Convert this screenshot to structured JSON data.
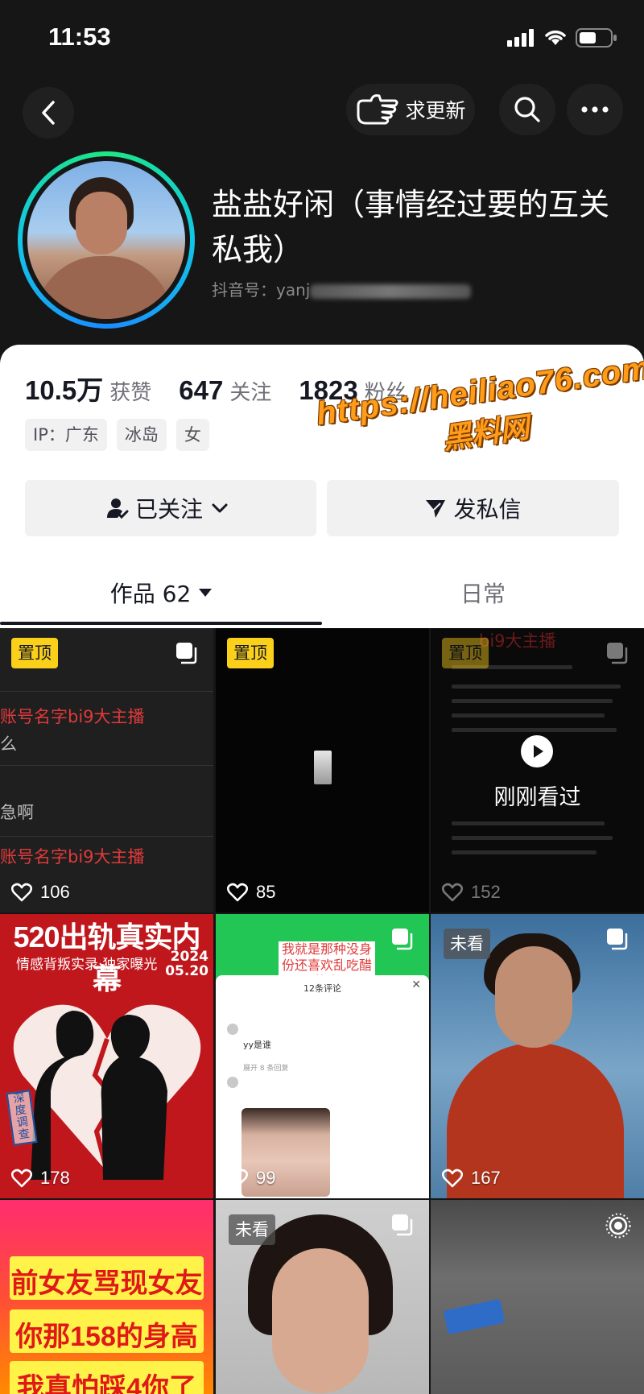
{
  "status_bar": {
    "time": "11:53"
  },
  "nav": {
    "update_label": "求更新"
  },
  "profile": {
    "nickname": "盐盐好闲（事情经过要的互关私我）",
    "id_prefix": "抖音号：",
    "id_visible": "yanj"
  },
  "stats": [
    {
      "value": "10.5万",
      "label": "获赞"
    },
    {
      "value": "647",
      "label": "关注"
    },
    {
      "value": "1823",
      "label": "粉丝"
    }
  ],
  "tags": [
    "IP：广东",
    "冰岛",
    "女"
  ],
  "watermark": {
    "url": "https://heiliao76.com",
    "name": "黑料网"
  },
  "actions": {
    "followed_label": "已关注",
    "message_label": "发私信"
  },
  "tabs": {
    "works_label": "作品 62",
    "daily_label": "日常"
  },
  "posts": [
    {
      "pin_label": "置顶",
      "likes": "106",
      "lines": [
        "账号名字bi9大主播",
        "么",
        "急啊",
        "账号名字bi9大主播"
      ]
    },
    {
      "pin_label": "置顶",
      "likes": "85"
    },
    {
      "pin_label": "置顶",
      "likes": "152",
      "overlay_text": "刚刚看过",
      "top_text": "bi9大主播"
    },
    {
      "likes": "178",
      "title": "520出轨真实内幕",
      "subtitle": "情感背叛实录·独家曝光",
      "date_year": "2024",
      "date_md": "05.20",
      "stamp": "深度调查"
    },
    {
      "likes": "99",
      "banner": "我就是那种没身份还喜欢乱吃醋的人",
      "sheet_title": "12条评论",
      "comment_1": "yy是谁",
      "expand": "展开 8 条回复"
    },
    {
      "likes": "167",
      "unseen_label": "未看"
    },
    {
      "lines": [
        "前女友骂现女友",
        "你那158的身高",
        "我真怕踩4你了"
      ]
    },
    {
      "unseen_label": "未看"
    },
    {}
  ]
}
